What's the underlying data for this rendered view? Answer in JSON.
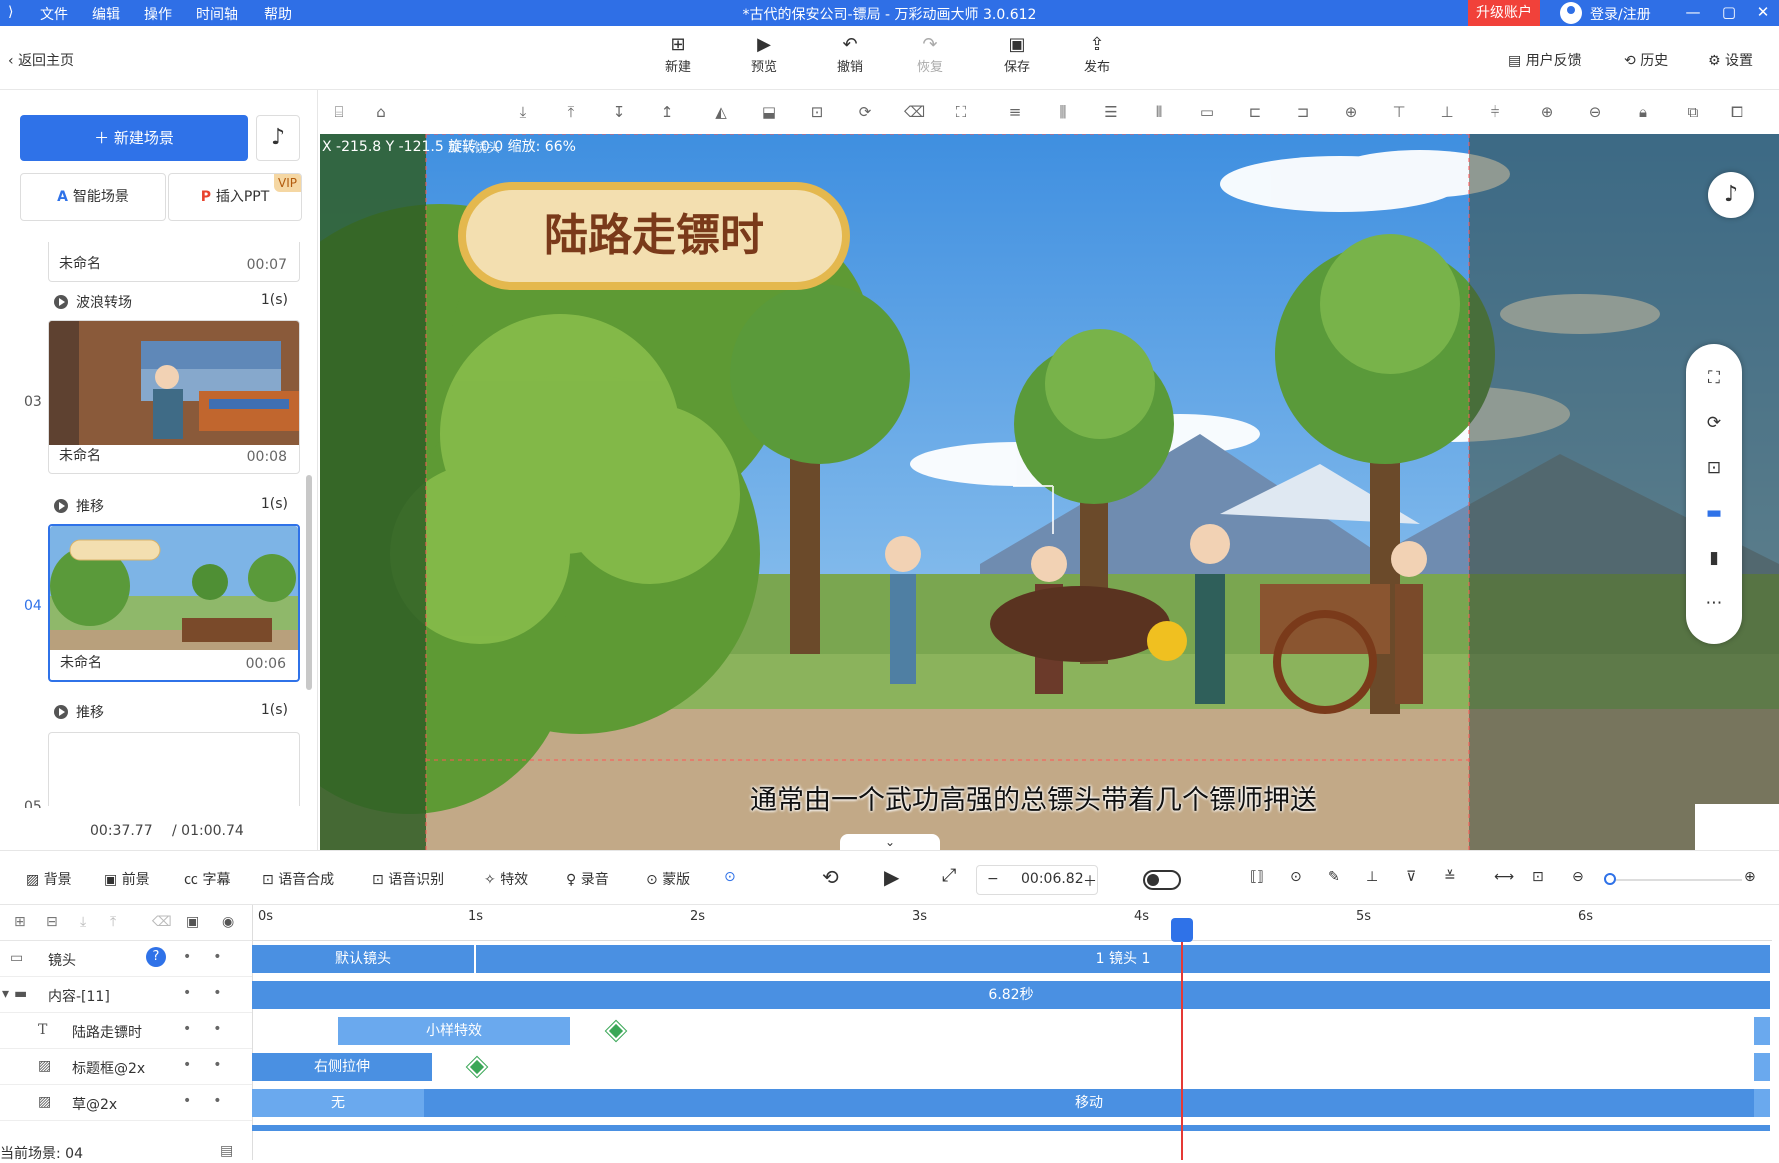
{
  "titlebar": {
    "menus": [
      "文件",
      "编辑",
      "操作",
      "时间轴",
      "帮助"
    ],
    "title": "*古代的保安公司-镖局 - 万彩动画大师 3.0.612",
    "upgrade": "升级账户",
    "login": "登录/注册"
  },
  "topbar": {
    "back": "返回主页",
    "buttons": [
      "新建",
      "预览",
      "撤销",
      "恢复",
      "保存",
      "发布"
    ],
    "feedback": "用户反馈",
    "history": "历史",
    "settings": "设置"
  },
  "left": {
    "new_scene": "新建场景",
    "smart_scene": "智能场景",
    "insert_ppt": "插入PPT",
    "vip": "VIP",
    "scenes": [
      {
        "index": "",
        "name": "未命名",
        "duration": "00:07"
      },
      {
        "index": "03",
        "name": "未命名",
        "duration": "00:08"
      },
      {
        "index": "04",
        "name": "未命名",
        "duration": "00:06"
      },
      {
        "index": "05",
        "name": "",
        "duration": ""
      }
    ],
    "transitions": [
      {
        "name": "波浪转场",
        "time": "1(s)"
      },
      {
        "name": "推移",
        "time": "1(s)"
      },
      {
        "name": "推移",
        "time": "1(s)"
      }
    ],
    "current_time": "00:37.77",
    "total_time": "/ 01:00.74"
  },
  "canvas": {
    "coords": "X -215.8 Y -121.5 旋转:0.0 缩放: 66%",
    "camera_label": "默认镜头",
    "banner_title": "陆路走镖时",
    "subtitle": "通常由一个武功高强的总镖头带着几个镖师押送"
  },
  "bottom_toolbar": {
    "tools": [
      "背景",
      "前景",
      "字幕",
      "语音合成",
      "语音识别",
      "特效",
      "录音",
      "蒙版"
    ],
    "time": "00:06.82"
  },
  "timeline": {
    "ticks": [
      "0s",
      "1s",
      "2s",
      "3s",
      "4s",
      "5s",
      "6s"
    ],
    "rows": [
      {
        "label": "镜头"
      },
      {
        "label": "内容-[11]"
      },
      {
        "label": "陆路走镖时"
      },
      {
        "label": "标题框@2x"
      },
      {
        "label": "草@2x"
      }
    ],
    "bars": {
      "camera_default": "默认镜头",
      "camera_1": "1 镜头 1",
      "content": "6.82秒",
      "title_effect": "小样特效",
      "frame_effect": "右侧拉伸",
      "grass_none": "无",
      "grass_move": "移动"
    },
    "current_scene": "当前场景: 04"
  },
  "colors": {
    "accent": "#2f72e8",
    "titlebar": "#2f6fe6",
    "upgrade": "#f1413a",
    "bar": "#4a90e2",
    "playhead": "#e53935",
    "keyframe": "#3aa757"
  }
}
